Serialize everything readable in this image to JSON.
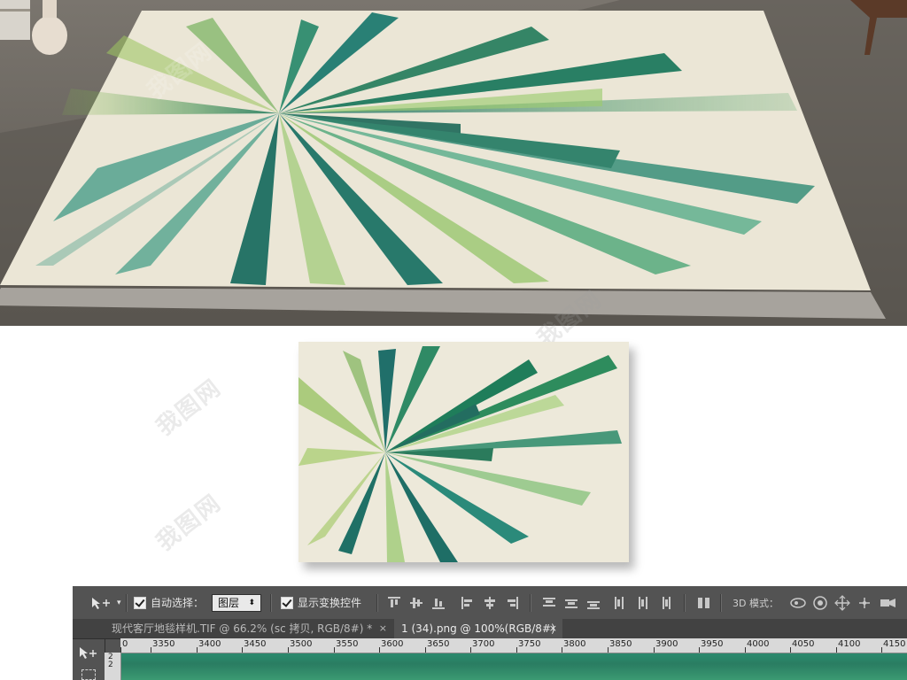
{
  "watermark": {
    "text": "我图网"
  },
  "photoshop": {
    "options_bar": {
      "move_tool": "move-tool-icon",
      "auto_select_label": "自动选择：",
      "auto_select_checked": true,
      "target_value": "图层",
      "show_transform_label": "显示变换控件",
      "show_transform_checked": true,
      "mode_3d_label": "3D 模式："
    },
    "tabs": [
      {
        "label": "现代客厅地毯样机.TIF @ 66.2% (sc 拷贝, RGB/8#) *",
        "close": "×",
        "active": false
      },
      {
        "label": "1 (34).png @ 100%(RGB/8#) *",
        "close": "×",
        "active": true
      }
    ],
    "ruler_ticks": [
      "0",
      "3350",
      "3400",
      "3450",
      "3500",
      "3550",
      "3600",
      "3650",
      "3700",
      "3750",
      "3800",
      "3850",
      "3900",
      "3950",
      "4000",
      "4050",
      "4100",
      "4150"
    ],
    "vertical_ruler": [
      "2",
      "2"
    ]
  }
}
